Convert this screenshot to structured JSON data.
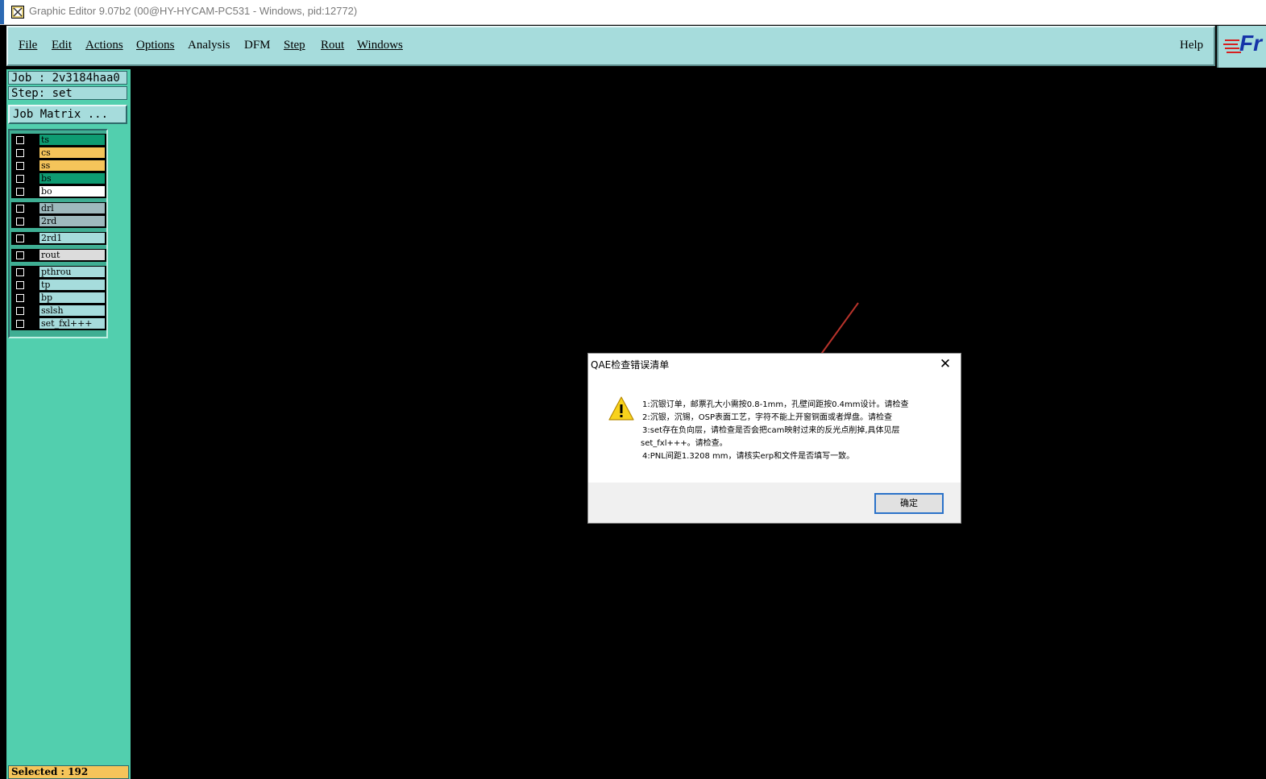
{
  "window": {
    "title": "Graphic Editor 9.07b2 (00@HY-HYCAM-PC531 - Windows, pid:12772)"
  },
  "menubar": {
    "items": [
      {
        "label": "File"
      },
      {
        "label": "Edit"
      },
      {
        "label": "Actions"
      },
      {
        "label": "Options"
      },
      {
        "label": "Analysis"
      },
      {
        "label": "DFM"
      },
      {
        "label": "Step"
      },
      {
        "label": "Rout"
      },
      {
        "label": "Windows"
      }
    ],
    "help": "Help",
    "logo_text": "Fr"
  },
  "sidebar": {
    "job": "Job : 2v3184haa0",
    "step": "Step: set",
    "job_matrix_button": "Job Matrix ...",
    "layers": [
      {
        "name": "ts",
        "color": "#0e9b72"
      },
      {
        "name": "cs",
        "color": "#f5c45a"
      },
      {
        "name": "ss",
        "color": "#f5c45a"
      },
      {
        "name": "bs",
        "color": "#0e9b72"
      },
      {
        "name": "bo",
        "color": "#ffffff"
      },
      {
        "name": "drl",
        "color": "#9eb9bd"
      },
      {
        "name": "2rd",
        "color": "#9eb9bd"
      },
      {
        "name": "2rd1",
        "color": "#a6dcdc"
      },
      {
        "name": "rout",
        "color": "#dcdcdc"
      },
      {
        "name": "pthrou",
        "color": "#a6dcdc"
      },
      {
        "name": "tp",
        "color": "#a6dcdc"
      },
      {
        "name": "bp",
        "color": "#a6dcdc"
      },
      {
        "name": "sslsh",
        "color": "#a6dcdc"
      },
      {
        "name": "set_fxl+++",
        "color": "#a6dcdc"
      }
    ],
    "selected": "Selected : 192"
  },
  "dialog": {
    "title": "QAE检查错误清单",
    "lines": [
      "1:沉银订单，邮票孔大小需按0.8-1mm，孔壁间距按0.4mm设计。请检查",
      "2:沉银，沉锡，OSP表面工艺，字符不能上开窗铜面或者焊盘。请检查",
      "3:set存在负向层，请检查是否会把cam映射过来的反光点削掉,具体见层",
      "set_fxl+++。请检查。",
      "4:PNL间距1.3208 mm，请核实erp和文件是否填写一致。"
    ],
    "ok_label": "确定",
    "close_glyph": "✕"
  },
  "colors": {
    "menubar_bg": "#a6dcdc",
    "panel_bg": "#52cfae",
    "canvas_bg": "#000000",
    "selected_bg": "#f5c45a",
    "annotation_arrow": "#c0392b"
  }
}
